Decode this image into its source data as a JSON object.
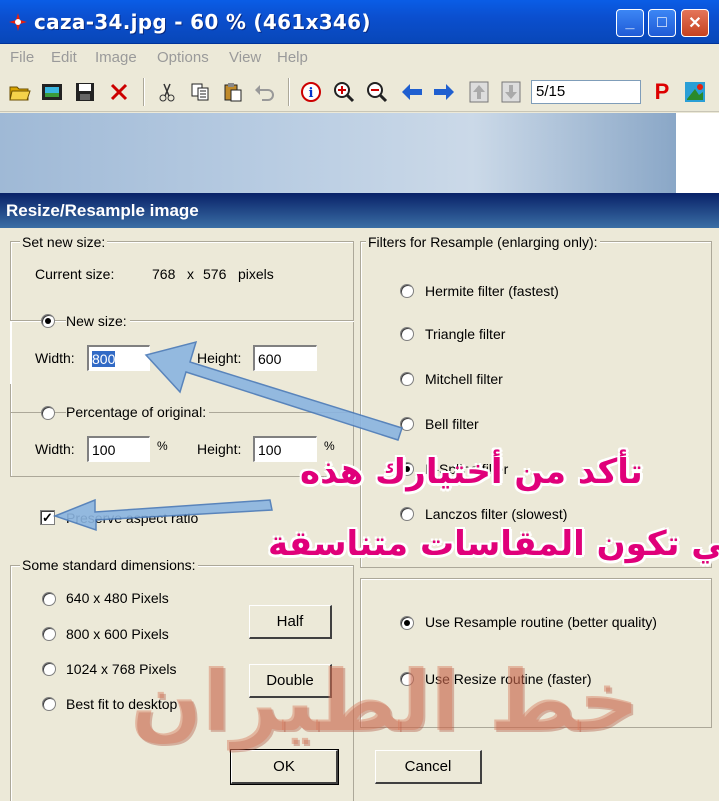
{
  "window": {
    "title": "caza-34.jpg - 60 % (461x346)",
    "min_glyph": "_",
    "max_glyph": "□",
    "close_glyph": "✕"
  },
  "menu": [
    "File",
    "Edit",
    "Image",
    "Options",
    "View",
    "Help"
  ],
  "toolbar": {
    "page_indicator": "5/15",
    "icons": [
      "open-folder-icon",
      "filmstrip-icon",
      "save-icon",
      "delete-icon",
      "cut-icon",
      "copy-icon",
      "paste-icon",
      "undo-icon",
      "info-icon",
      "zoom-in-icon",
      "zoom-out-icon",
      "arrow-left-icon",
      "arrow-right-icon",
      "arrow-up-icon",
      "arrow-down-icon",
      "print-icon",
      "paint-icon"
    ],
    "print_glyph": "P"
  },
  "dialog": {
    "title": "Resize/Resample image",
    "set_new_size": {
      "legend": "Set new size:",
      "current_size_label": "Current size:",
      "current_width": "768",
      "times": "x",
      "current_height": "576",
      "units": "pixels"
    },
    "new_size": {
      "label": "New size:",
      "width_label": "Width:",
      "width_value": "800",
      "height_label": "Height:",
      "height_value": "600",
      "selected": true
    },
    "percentage": {
      "label": "Percentage of original:",
      "width_label": "Width:",
      "width_value": "100",
      "pct_symbol": "%",
      "height_label": "Height:",
      "height_value": "100",
      "selected": false
    },
    "preserve_aspect": {
      "label": "Preserve aspect ratio",
      "checked": true,
      "check_glyph": "✓"
    },
    "standard_dimensions": {
      "legend": "Some standard dimensions:",
      "options": [
        "640 x 480 Pixels",
        "800 x 600 Pixels",
        "1024 x 768 Pixels",
        "Best fit to desktop"
      ],
      "half_label": "Half",
      "double_label": "Double"
    },
    "filters": {
      "legend": "Filters for Resample (enlarging only):",
      "options": [
        "Hermite filter (fastest)",
        "Triangle filter",
        "Mitchell filter",
        "Bell filter",
        "B-Spline filter",
        "Lanczos filter (slowest)"
      ],
      "selected_index": 4
    },
    "routine": {
      "options": [
        "Use Resample routine (better quality)",
        "Use Resize routine (faster)"
      ],
      "selected_index": 0
    },
    "ok_label": "OK",
    "cancel_label": "Cancel"
  },
  "annotations": {
    "line1": "تأكد من أختيارك هذه",
    "line2": "كي تكون المقاسات متناسقة",
    "watermark": "خط الطيران",
    "color": "#e0007a",
    "arrow_color": "#8ab4e0"
  }
}
